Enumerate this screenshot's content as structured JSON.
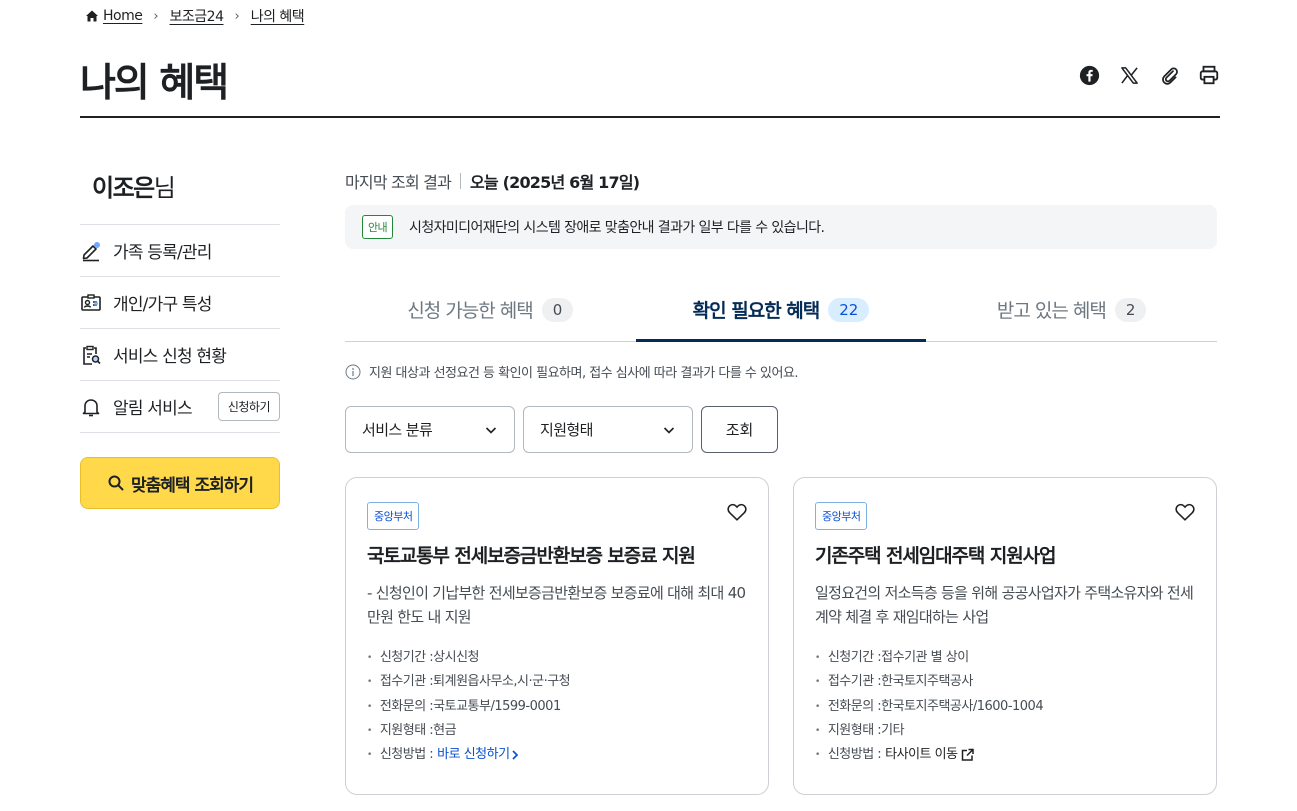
{
  "breadcrumb": {
    "home": "Home",
    "level1": "보조금24",
    "level2": "나의 혜택"
  },
  "page": {
    "title": "나의 혜택"
  },
  "share": {
    "icons": [
      "facebook-icon",
      "x-icon",
      "link-copy-icon",
      "print-icon"
    ]
  },
  "sidebar": {
    "user_name": "이조은",
    "user_suffix": "님",
    "items": [
      {
        "label": "가족 등록/관리",
        "icon": "pencil-icon"
      },
      {
        "label": "개인/가구 특성",
        "icon": "id-card-icon"
      },
      {
        "label": "서비스 신청 현황",
        "icon": "clipboard-search-icon"
      },
      {
        "label": "알림 서비스",
        "icon": "bell-icon",
        "button": "신청하기"
      }
    ],
    "cta_label": "맞춤혜택 조회하기"
  },
  "main": {
    "last_lookup_label": "마지막 조회 결과",
    "last_lookup_value": "오늘 (2025년 6월 17일)",
    "notice_badge": "안내",
    "notice_text": "시청자미디어재단의 시스템 장애로 맞춤안내 결과가 일부 다를 수 있습니다.",
    "tabs": [
      {
        "label": "신청 가능한 혜택",
        "count": "0"
      },
      {
        "label": "확인 필요한 혜택",
        "count": "22",
        "active": true
      },
      {
        "label": "받고 있는 혜택",
        "count": "2"
      }
    ],
    "info_text": "지원 대상과 선정요건 등 확인이 필요하며, 접수 심사에 따라 결과가 다를 수 있어요.",
    "filters": {
      "category": "서비스 분류",
      "support_type": "지원형태",
      "search_button": "조회"
    },
    "cards": [
      {
        "tag": "중앙부처",
        "title": "국토교통부 전세보증금반환보증 보증료 지원",
        "desc": "- 신청인이 기납부한 전세보증금반환보증 보증료에 대해 최대 40만원 한도 내 지원",
        "fields": [
          {
            "k": "신청기간 : ",
            "v": "상시신청"
          },
          {
            "k": "접수기관 : ",
            "v": "퇴계원읍사무소,시·군·구청"
          },
          {
            "k": "전화문의 : ",
            "v": "국토교통부/1599-0001"
          },
          {
            "k": "지원형태 : ",
            "v": "현금"
          },
          {
            "k": "신청방법 : ",
            "v": "바로 신청하기"
          }
        ]
      },
      {
        "tag": "중앙부처",
        "title": "기존주택 전세임대주택 지원사업",
        "desc": "일정요건의 저소득층 등을 위해 공공사업자가 주택소유자와 전세계약 체결 후 재임대하는 사업",
        "fields": [
          {
            "k": "신청기간 : ",
            "v": "접수기관 별 상이"
          },
          {
            "k": "접수기관 : ",
            "v": "한국토지주택공사"
          },
          {
            "k": "전화문의 : ",
            "v": "한국토지주택공사/1600-1004"
          },
          {
            "k": "지원형태 : ",
            "v": "기타"
          },
          {
            "k": "신청방법 : ",
            "v": "타사이트 이동"
          }
        ]
      }
    ]
  }
}
